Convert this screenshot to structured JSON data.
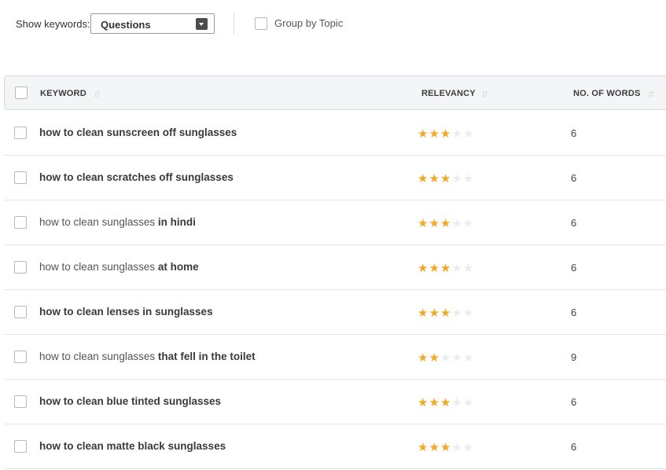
{
  "toolbar": {
    "show_keywords_label": "Show keywords:",
    "keyword_type_selected": "Questions",
    "group_by_topic_label": "Group by Topic",
    "group_by_topic_checked": false
  },
  "table": {
    "columns": {
      "keyword": "KEYWORD",
      "relevancy": "RELEVANCY",
      "words": "NO. OF WORDS"
    },
    "rows": [
      {
        "base": "",
        "modifier": "how to clean sunscreen off sunglasses",
        "relevancy_stars": 3,
        "words": "6"
      },
      {
        "base": "",
        "modifier": "how to clean scratches off sunglasses",
        "relevancy_stars": 3,
        "words": "6"
      },
      {
        "base": "how to clean sunglasses",
        "modifier": "in hindi",
        "relevancy_stars": 3,
        "words": "6"
      },
      {
        "base": "how to clean sunglasses",
        "modifier": "at home",
        "relevancy_stars": 3,
        "words": "6"
      },
      {
        "base": "",
        "modifier": "how to clean lenses in sunglasses",
        "relevancy_stars": 3,
        "words": "6"
      },
      {
        "base": "how to clean sunglasses",
        "modifier": "that fell in the toilet",
        "relevancy_stars": 2,
        "words": "9"
      },
      {
        "base": "",
        "modifier": "how to clean blue tinted sunglasses",
        "relevancy_stars": 3,
        "words": "6"
      },
      {
        "base": "",
        "modifier": "how to clean matte black sunglasses",
        "relevancy_stars": 3,
        "words": "6"
      }
    ],
    "max_stars": 5
  },
  "colors": {
    "star_filled": "#f5a623",
    "star_empty": "#ececec",
    "header_bg": "#f3f5f7"
  }
}
